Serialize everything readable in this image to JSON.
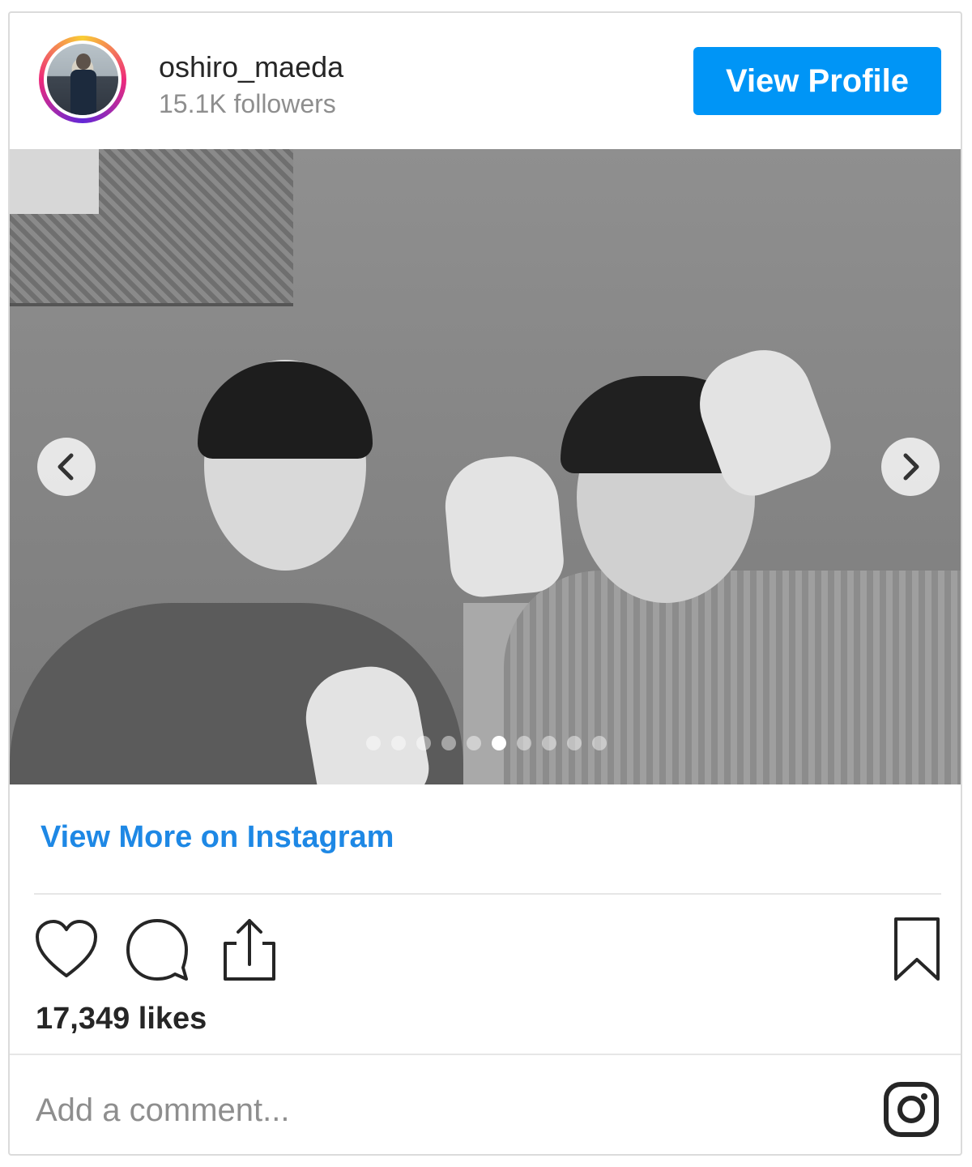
{
  "header": {
    "username": "oshiro_maeda",
    "followers": "15.1K followers",
    "view_profile_label": "View Profile",
    "avatar_icon": "profile-avatar"
  },
  "carousel": {
    "image_alt": "black and white photo of two people waving",
    "prev_icon": "chevron-left-icon",
    "next_icon": "chevron-right-icon",
    "dot_count": 10,
    "active_index": 5
  },
  "footer": {
    "view_more": "View More on Instagram",
    "likes": "17,349 likes",
    "comment_placeholder": "Add a comment..."
  },
  "colors": {
    "accent": "#0095f6",
    "link": "#1e88e5",
    "text": "#262626",
    "muted": "#8e8e8e"
  }
}
